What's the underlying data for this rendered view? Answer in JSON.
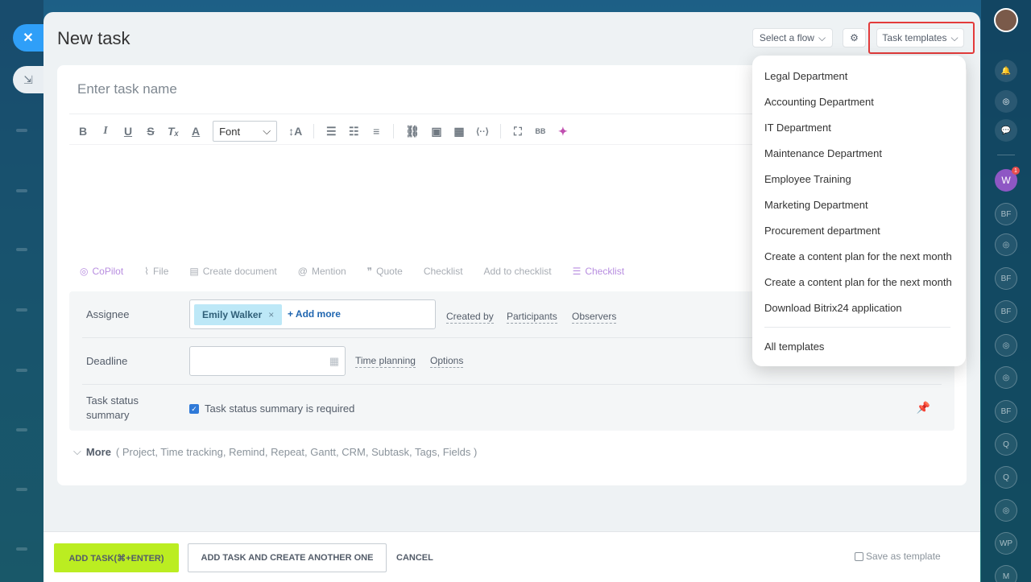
{
  "header": {
    "title": "New task",
    "flow_select": "Select a flow",
    "templates_button": "Task templates"
  },
  "editor": {
    "task_name_placeholder": "Enter task name",
    "font_select": "Font",
    "toolbar": {
      "bold": "B",
      "italic": "I",
      "underline": "U",
      "strike": "S",
      "clear": "Tₓ",
      "color": "A",
      "size": "↕A",
      "numbered": "☰",
      "bullets": "☷",
      "align": "≡",
      "link": "⛓",
      "image": "▣",
      "table": "▦",
      "code": "⟨··⟩",
      "fullscreen": "⛶",
      "bbcode": "BB",
      "copilot_img": "✦"
    }
  },
  "actions": {
    "copilot": "CoPilot",
    "file": "File",
    "create_document": "Create document",
    "mention": "Mention",
    "quote": "Quote",
    "checklist": "Checklist",
    "add_to_checklist": "Add to checklist",
    "checklist2": "Checklist"
  },
  "fields": {
    "assignee_label": "Assignee",
    "assignee_name": "Emily Walker",
    "add_more": "+ Add more",
    "created_by": "Created by",
    "participants": "Participants",
    "observers": "Observers",
    "deadline_label": "Deadline",
    "time_planning": "Time planning",
    "options": "Options",
    "status_label_1": "Task status",
    "status_label_2": "summary",
    "status_check_label": "Task status summary is required"
  },
  "more": {
    "label": "More",
    "items": "( Project,  Time tracking,  Remind,  Repeat,  Gantt,  CRM,  Subtask,  Tags,  Fields )"
  },
  "footer": {
    "add_task": "ADD TASK(⌘+ENTER)",
    "add_another": "ADD TASK AND CREATE ANOTHER ONE",
    "cancel": "CANCEL",
    "save_as_template": "Save as template"
  },
  "templates_dropdown": {
    "items": [
      "Legal Department",
      "Accounting Department",
      "IT Department",
      "Maintenance Department",
      "Employee Training",
      "Marketing Department",
      "Procurement department",
      "Create a content plan for the next month",
      "Create a content plan for the next month",
      "Download Bitrix24 application"
    ],
    "all_templates": "All templates"
  },
  "right_bar": {
    "avatar_w": "W",
    "badge": "1",
    "avatars": [
      "BF",
      "BF",
      "BF",
      "BF",
      "Q",
      "Q",
      "WP",
      "M"
    ]
  },
  "colors": {
    "accent_blue": "#2f9ff8",
    "add_button_green": "#bbed21",
    "highlight_red": "#e33b3b",
    "checkbox_blue": "#2f7ad8"
  }
}
